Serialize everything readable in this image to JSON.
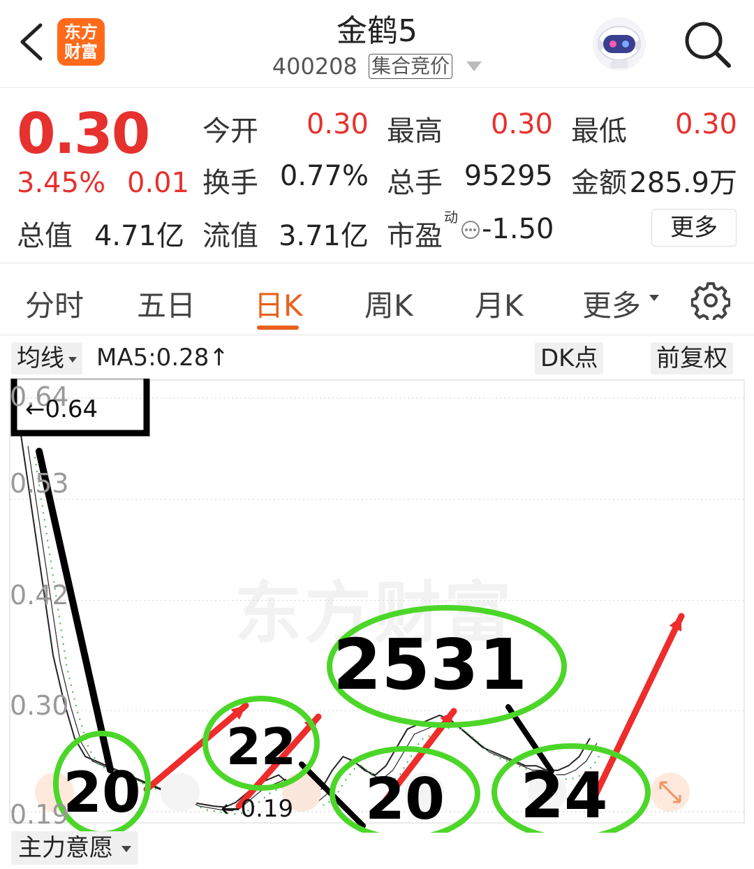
{
  "header": {
    "title": "金鹤5",
    "code": "400208",
    "auction_tag": "集合竞价",
    "logo_text_line1": "东方",
    "logo_text_line2": "财富"
  },
  "quote": {
    "price": "0.30",
    "change_pct": "3.45%",
    "change_abs": "0.01",
    "open_label": "今开",
    "open": "0.30",
    "high_label": "最高",
    "high": "0.30",
    "low_label": "最低",
    "low": "0.30",
    "turnover_label": "换手",
    "turnover": "0.77%",
    "volume_label": "总手",
    "volume": "95295",
    "amount_label": "金额",
    "amount": "285.9万",
    "mktcap_label": "总值",
    "mktcap": "4.71亿",
    "float_label": "流值",
    "float": "3.71亿",
    "pe_label": "市盈",
    "pe_sup": "动",
    "pe": "-1.50",
    "more_button": "更多"
  },
  "tabs": [
    {
      "label": "分时"
    },
    {
      "label": "五日"
    },
    {
      "label": "日K",
      "active": true
    },
    {
      "label": "周K"
    },
    {
      "label": "月K"
    },
    {
      "label": "更多"
    }
  ],
  "chart_toolbar": {
    "indicator_select": "均线",
    "ma5_text": "MA5:0.28↑",
    "dk_button": "DK点",
    "adjust_button": "前复权"
  },
  "chart_data": {
    "type": "line",
    "yticks": [
      "0.64",
      "0.53",
      "0.42",
      "0.30",
      "0.19"
    ],
    "max_label": "←0.64",
    "min_label": "←0.19",
    "watermark": "东方财富",
    "handwritten_annotations": [
      "20",
      "22",
      "2531",
      "20",
      "24"
    ],
    "ma5": [
      0.6,
      0.52,
      0.44,
      0.36,
      0.31,
      0.27,
      0.25,
      0.245,
      0.24,
      0.235,
      0.23,
      0.225,
      0.22,
      0.215,
      0.21,
      0.205,
      0.2,
      0.198,
      0.196,
      0.195,
      0.2,
      0.21,
      0.22,
      0.225,
      0.23,
      0.22,
      0.21,
      0.205,
      0.215,
      0.235,
      0.25,
      0.245,
      0.235,
      0.23,
      0.24,
      0.26,
      0.28,
      0.285,
      0.29,
      0.295,
      0.29,
      0.28,
      0.27,
      0.26,
      0.255,
      0.25,
      0.245,
      0.24,
      0.24,
      0.235,
      0.235,
      0.24,
      0.25,
      0.27
    ],
    "ylim": [
      0.19,
      0.64
    ]
  },
  "bottom": {
    "indicator_select": "主力意愿"
  },
  "colors": {
    "up": "#e6312e",
    "accent": "#e8601c",
    "annotation_green": "#4cd629",
    "annotation_red": "#ee2c2c"
  }
}
